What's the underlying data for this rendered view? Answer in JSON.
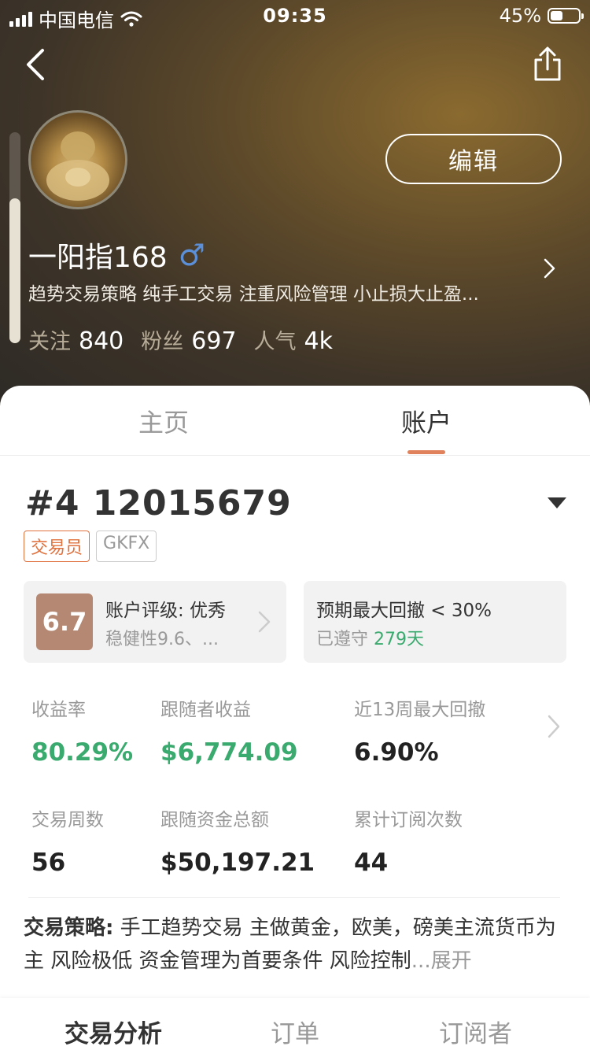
{
  "status_bar": {
    "carrier": "中国电信",
    "time": "09:35",
    "battery_percent": "45%",
    "battery_level": 0.45
  },
  "profile": {
    "name": "一阳指168",
    "gender_symbol": "♂",
    "bio": "趋势交易策略 纯手工交易 注重风险管理 小止损大止盈...",
    "edit_label": "编辑",
    "stats": [
      {
        "label": "关注",
        "value": "840"
      },
      {
        "label": "粉丝",
        "value": "697"
      },
      {
        "label": "人气",
        "value": "4k"
      }
    ]
  },
  "tabs": [
    {
      "label": "主页",
      "active": false
    },
    {
      "label": "账户",
      "active": true
    }
  ],
  "account": {
    "title": "#4 12015679",
    "tags": [
      "交易员",
      "GKFX"
    ],
    "rating": {
      "score": "6.7",
      "title": "账户评级: 优秀",
      "subtitle": "稳健性9.6、..."
    },
    "drawdown": {
      "title": "预期最大回撤 < 30%",
      "prefix": "已遵守 ",
      "days": "279天"
    },
    "metrics": [
      {
        "label": "收益率",
        "value": "80.29%",
        "color": "#3aaa6e"
      },
      {
        "label": "跟随者收益",
        "value": "$6,774.09",
        "color": "#3aaa6e"
      },
      {
        "label": "近13周最大回撤",
        "value": "6.90%"
      },
      {
        "label": "交易周数",
        "value": "56"
      },
      {
        "label": "跟随资金总额",
        "value": "$50,197.21"
      },
      {
        "label": "累计订阅次数",
        "value": "44"
      }
    ],
    "strategy": {
      "label": "交易策略:",
      "text": " 手工趋势交易 主做黄金，欧美，磅美主流货币为主 风险极低 资金管理为首要条件 风险控制",
      "more": "...展开"
    }
  },
  "bottom_tabs": [
    {
      "label": "交易分析",
      "active": true
    },
    {
      "label": "订单",
      "active": false
    },
    {
      "label": "订阅者",
      "active": false
    }
  ],
  "colors": {
    "accent": "#e0825b",
    "green": "#3aaa6e"
  }
}
